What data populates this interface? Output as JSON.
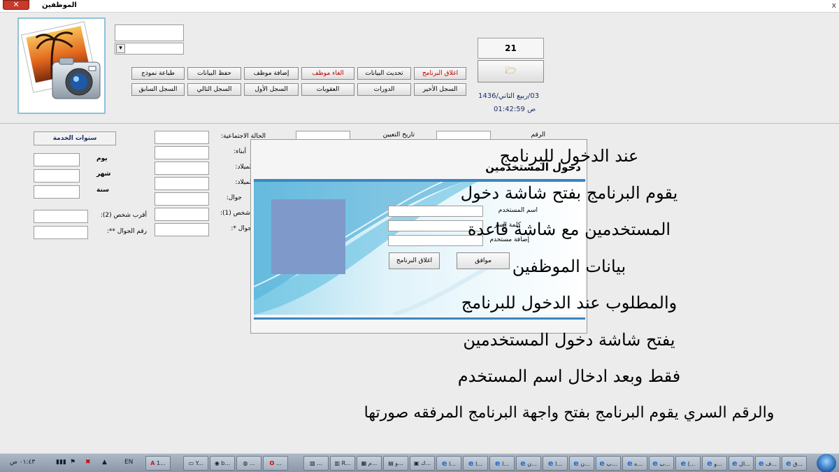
{
  "window": {
    "title": "الموظفين",
    "close_glyph": "✕",
    "mini_close_glyph": "x"
  },
  "header": {
    "buttons_row1": [
      {
        "label": "طباعة نموذج",
        "red": false
      },
      {
        "label": "حفظ البيانات",
        "red": false
      },
      {
        "label": "إضافة موظف",
        "red": false
      },
      {
        "label": "الغاء موظف",
        "red": true
      },
      {
        "label": "تحديث البيانات",
        "red": false
      },
      {
        "label": "اغلاق البرنامج",
        "red": true
      }
    ],
    "buttons_row2": [
      {
        "label": "السجل السابق"
      },
      {
        "label": "السجل التالي"
      },
      {
        "label": "السجل الأول"
      },
      {
        "label": "العقوبات"
      },
      {
        "label": "الدورات"
      },
      {
        "label": "السجل الأخير"
      }
    ],
    "counter": "21",
    "open_icon": "🗁",
    "hijri_date": "03/ربيع الثاني/1436",
    "time": "01:42:59 ص",
    "combo_arrow": "▾"
  },
  "form": {
    "service_years_title": "سنوات الخدمة",
    "day_label": "يوم",
    "month_label": "شهر",
    "year_label": "سنة",
    "nearest_person_label": "أقرب شخص (2):",
    "mobile_label": "رقم الجوال **:",
    "marital_label": "الحالة الاجتماعية:",
    "children_label": "أبناء:",
    "birth_label_1": "الميلاد:",
    "birth_label_2": "الميلاد:",
    "mobile_short_label": "جوال:",
    "person1_label": "شخص (1):",
    "mobile2_label": "جوال *:",
    "hire_date_label": "تاريخ التعيين",
    "number_label": "الرقم"
  },
  "login_dialog": {
    "title": "دخول المستخدمين",
    "username_label": "اسم المستخدم",
    "password_label": "كلمة السر",
    "add_user_label": "إضافة مستخدم",
    "ok_button": "موافق",
    "close_button": "اغلاق البرنامج"
  },
  "caption": {
    "lines": [
      "عند الدخول للبرنامج",
      "يقوم البرنامج بفتح شاشة دخول",
      "المستخدمين مع شاشة قاعدة",
      "بيانات الموظفين",
      "والمطلوب عند الدخول للبرنامج",
      "يفتح شاشة دخول المستخدمين",
      "فقط وبعد ادخال اسم المستخدم",
      "والرقم السري يقوم البرنامج بفتح واجهة البرنامج المرفقه صورتها"
    ]
  },
  "taskbar": {
    "clock": "٠١:٤٣ ص",
    "language": "EN",
    "items": [
      "ق...",
      "ف...",
      "ال...",
      "و...",
      "(...",
      "ب...",
      "ه...",
      "ب...",
      "ن...",
      "ا...",
      "ن...",
      "ا...",
      "ا...",
      "ا...",
      "ك...",
      "و...",
      "م...",
      "R...",
      "...",
      "...",
      "...",
      "b...",
      "Y...",
      "1..."
    ]
  },
  "colors": {
    "accent_blue": "#3a86c2",
    "dark_text_blue": "#1c2c68",
    "alert_red": "#c00000"
  }
}
